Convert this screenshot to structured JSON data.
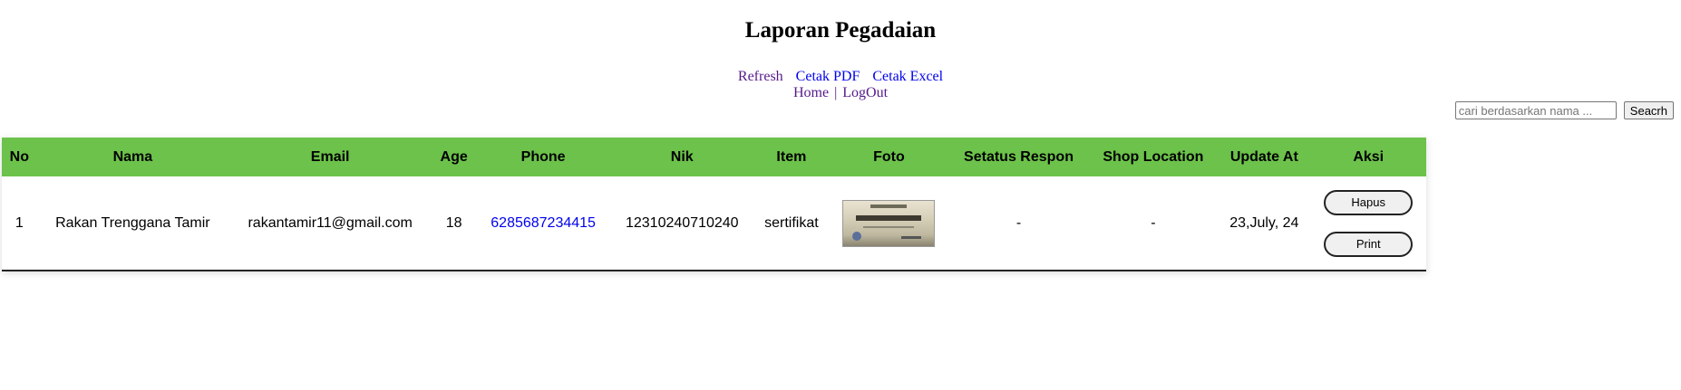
{
  "page": {
    "title": "Laporan Pegadaian"
  },
  "nav": {
    "refresh": "Refresh",
    "pdf": "Cetak PDF",
    "excel": "Cetak Excel",
    "home": "Home",
    "separator": "|",
    "logout": "LogOut"
  },
  "search": {
    "placeholder": "cari berdasarkan nama ...",
    "button": "Seacrh"
  },
  "colors": {
    "header_bg": "#6cc24a",
    "link_visited": "#551a8b",
    "link_fresh": "#0000ee"
  },
  "table": {
    "columns": [
      "No",
      "Nama",
      "Email",
      "Age",
      "Phone",
      "Nik",
      "Item",
      "Foto",
      "Setatus Respon",
      "Shop Location",
      "Update At",
      "Aksi"
    ],
    "rows": [
      {
        "no": "1",
        "nama": "Rakan Trenggana Tamir",
        "email": "rakantamir11@gmail.com",
        "age": "18",
        "phone": "6285687234415",
        "nik": "12310240710240",
        "item": "sertifikat",
        "status": "-",
        "shop_location": "-",
        "update_at": "23,July, 24",
        "actions": {
          "delete": "Hapus",
          "print": "Print"
        }
      }
    ]
  }
}
